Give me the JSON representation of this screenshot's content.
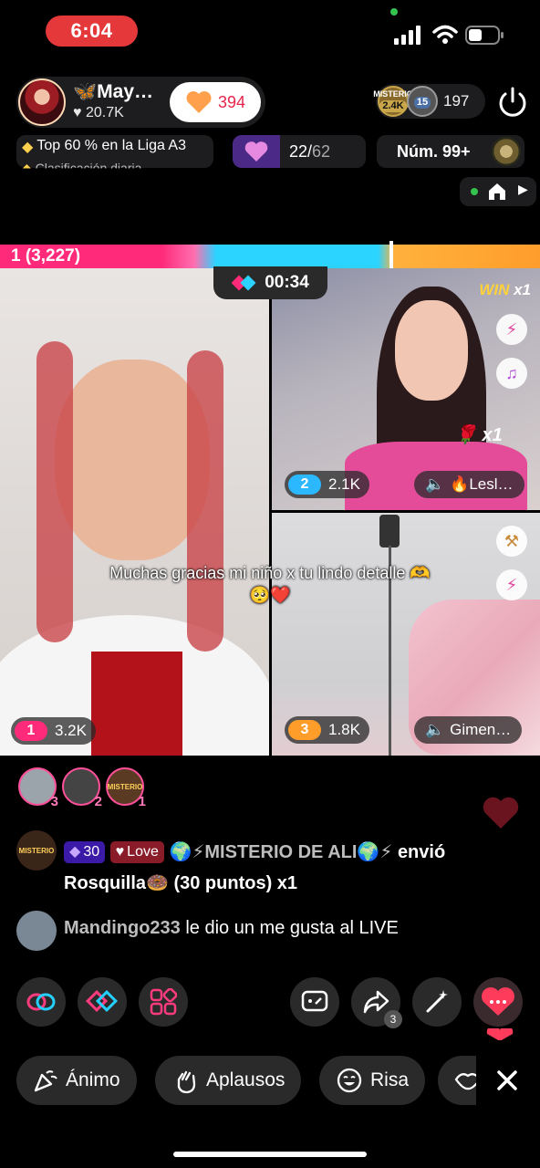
{
  "status_bar": {
    "time": "6:04"
  },
  "host": {
    "name": "May…",
    "likes": "20.7K",
    "follow_count": "394"
  },
  "viewers": {
    "badge1_label": "MISTERIO",
    "badge1_value": "2.4K",
    "badge2_value": "15",
    "count": "197"
  },
  "league": {
    "text": "Top 60 % en la Liga A3",
    "sub": "Clasificación diaria"
  },
  "goal": {
    "progress": "22/",
    "total": "62"
  },
  "rank": {
    "text": "Núm. 99+"
  },
  "battle": {
    "left_rank": "1",
    "left_score": "(3,227)",
    "timer": "00:34"
  },
  "panels": {
    "main": {
      "rank": "1",
      "score": "3.2K",
      "rank_color": "#ff2b7a"
    },
    "top_right": {
      "rank": "2",
      "score": "2.1K",
      "rank_color": "#2bb8ff",
      "name": "🔥Lesl…",
      "win_label": "WIN",
      "win_count": "x1",
      "gift_count": "x1"
    },
    "bottom_right": {
      "rank": "3",
      "score": "1.8K",
      "rank_color": "#ff9d2b",
      "name": "Gimen…"
    }
  },
  "caption": "Muchas gracias mi niño x tu lindo detalle 🫶🥺❤️",
  "gifters": [
    {
      "rank": "3"
    },
    {
      "rank": "2"
    },
    {
      "rank": "1",
      "label": "MISTERIO"
    }
  ],
  "chat": [
    {
      "badge_level": "30",
      "badge_love": "Love",
      "user": "🌍⚡MISTERIO DE ALI🌍⚡",
      "action": "envió",
      "line2": "Rosquilla🍩 (30 puntos) x1"
    },
    {
      "user": "Mandingo233",
      "text": "le dio un me gusta al LIVE"
    }
  ],
  "actions": {
    "share_count": "3"
  },
  "reactions": [
    "Ánimo",
    "Aplausos",
    "Risa"
  ]
}
